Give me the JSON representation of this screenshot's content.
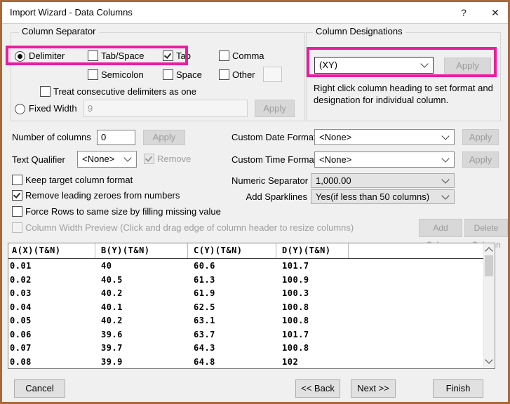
{
  "window": {
    "title": "Import Wizard - Data Columns",
    "help_label": "?",
    "close_label": "✕"
  },
  "column_separator": {
    "group_label": "Column Separator",
    "delimiter_label": "Delimiter",
    "tab_space_label": "Tab/Space",
    "tab_label": "Tab",
    "comma_label": "Comma",
    "semicolon_label": "Semicolon",
    "space_label": "Space",
    "other_label": "Other",
    "other_value": "",
    "treat_consecutive_label": "Treat consecutive delimiters as one",
    "fixed_width_label": "Fixed Width",
    "fixed_width_value": "9",
    "apply_label": "Apply"
  },
  "column_designations": {
    "group_label": "Column Designations",
    "designation_value": "(XY)",
    "apply_label": "Apply",
    "hint": "Right click column heading to set format and designation for individual column."
  },
  "options_left": {
    "number_of_columns_label": "Number of columns",
    "number_of_columns_value": "0",
    "apply_label": "Apply",
    "text_qualifier_label": "Text Qualifier",
    "text_qualifier_value": "<None>",
    "remove_label": "Remove",
    "keep_target_label": "Keep target column format",
    "remove_leading_label": "Remove leading zeroes from numbers",
    "force_rows_label": "Force Rows to same size by filling missing value",
    "column_width_preview_label": "Column Width Preview (Click and drag edge of column header to resize columns)"
  },
  "options_right": {
    "custom_date_label": "Custom Date Format",
    "custom_date_value": "<None>",
    "custom_date_apply": "Apply",
    "custom_time_label": "Custom Time Format",
    "custom_time_value": "<None>",
    "custom_time_apply": "Apply",
    "numeric_separator_label": "Numeric Separator",
    "numeric_separator_value": "1,000.00",
    "add_sparklines_label": "Add Sparklines",
    "add_sparklines_value": "Yes(if less than 50 columns)",
    "add_column_label": "Add Column",
    "delete_column_label": "Delete Column"
  },
  "preview_table": {
    "headers": [
      "A(X)(T&N)",
      "B(Y)(T&N)",
      "C(Y)(T&N)",
      "D(Y)(T&N)"
    ],
    "rows": [
      [
        "0.01",
        "40",
        "60.6",
        "101.7"
      ],
      [
        "0.02",
        "40.5",
        "61.3",
        "100.9"
      ],
      [
        "0.03",
        "40.2",
        "61.9",
        "100.3"
      ],
      [
        "0.04",
        "40.1",
        "62.5",
        "100.8"
      ],
      [
        "0.05",
        "40.2",
        "63.1",
        "100.8"
      ],
      [
        "0.06",
        "39.6",
        "63.7",
        "101.7"
      ],
      [
        "0.07",
        "39.7",
        "64.3",
        "100.8"
      ],
      [
        "0.08",
        "39.9",
        "64.8",
        "102"
      ]
    ]
  },
  "footer": {
    "cancel_label": "Cancel",
    "back_label": "<< Back",
    "next_label": "Next >>",
    "finish_label": "Finish"
  },
  "states": {
    "delimiter": true,
    "fixed_width": false,
    "tab_space": false,
    "tab": true,
    "comma": false,
    "semicolon": false,
    "space": false,
    "other": false,
    "treat_consecutive": false,
    "remove": true,
    "keep_target": false,
    "remove_leading": true,
    "force_rows": false,
    "column_width_preview": false
  },
  "colors": {
    "highlight": "#EA1C9F",
    "window_border": "#A9693B"
  }
}
